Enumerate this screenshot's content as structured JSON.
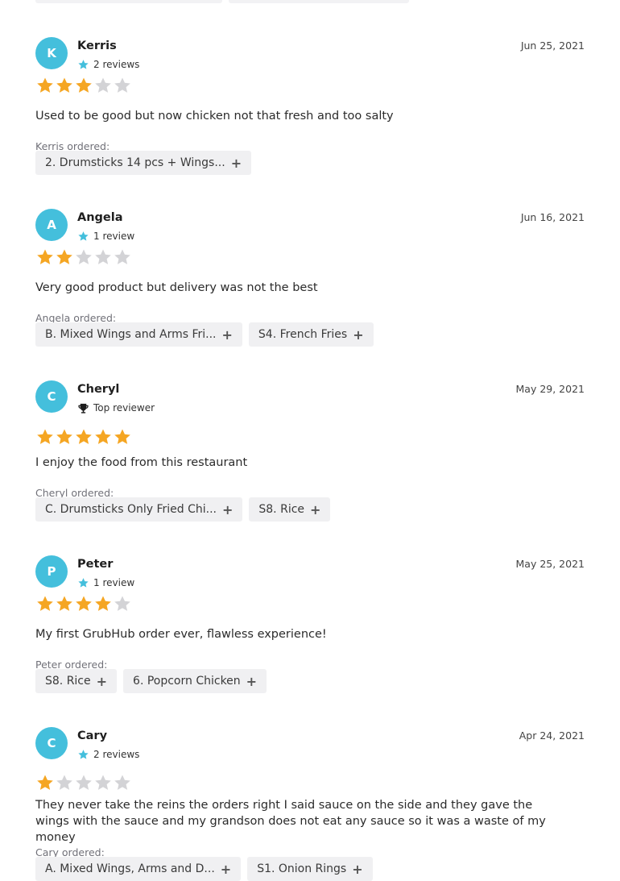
{
  "reviews": [
    {
      "initial": "K",
      "name": "Kerris",
      "meta_icon": "star-icon",
      "meta_text": "2 reviews",
      "date": "Jun 25, 2021",
      "rating": 3,
      "text": "Used to be good but now chicken not that fresh and too salty",
      "ordered_label": "Kerris ordered:",
      "items": [
        "2. Drumsticks 14 pcs + Wings..."
      ]
    },
    {
      "initial": "A",
      "name": "Angela",
      "meta_icon": "star-icon",
      "meta_text": "1 review",
      "date": "Jun 16, 2021",
      "rating": 2,
      "text": "Very good product but delivery was not the best",
      "ordered_label": "Angela ordered:",
      "items": [
        "B. Mixed Wings and Arms Fri...",
        "S4. French Fries"
      ]
    },
    {
      "initial": "C",
      "name": "Cheryl",
      "meta_icon": "trophy-icon",
      "meta_text": "Top reviewer",
      "date": "May 29, 2021",
      "rating": 5,
      "text": "I enjoy the food from this restaurant",
      "ordered_label": "Cheryl ordered:",
      "items": [
        "C. Drumsticks Only Fried Chi...",
        "S8. Rice"
      ]
    },
    {
      "initial": "P",
      "name": "Peter",
      "meta_icon": "star-icon",
      "meta_text": "1 review",
      "date": "May 25, 2021",
      "rating": 4,
      "text": "My first GrubHub order ever, flawless experience!",
      "ordered_label": "Peter ordered:",
      "items": [
        "S8. Rice",
        "6. Popcorn Chicken"
      ]
    },
    {
      "initial": "C",
      "name": "Cary",
      "meta_icon": "star-icon",
      "meta_text": "2 reviews",
      "date": "Apr 24, 2021",
      "rating": 1,
      "text": "They never take the reins the orders right I said sauce on the side and they gave the wings with the sauce and my grandson does not eat any sauce so it was a waste of my money",
      "ordered_label": "Cary ordered:",
      "items": [
        "A. Mixed Wings, Arms and D...",
        "S1. Onion Rings"
      ]
    }
  ],
  "colors": {
    "avatar": "#44bfdc",
    "star_filled": "#f5a623",
    "star_empty": "#d3d3d6",
    "meta_star": "#44bfdc"
  }
}
